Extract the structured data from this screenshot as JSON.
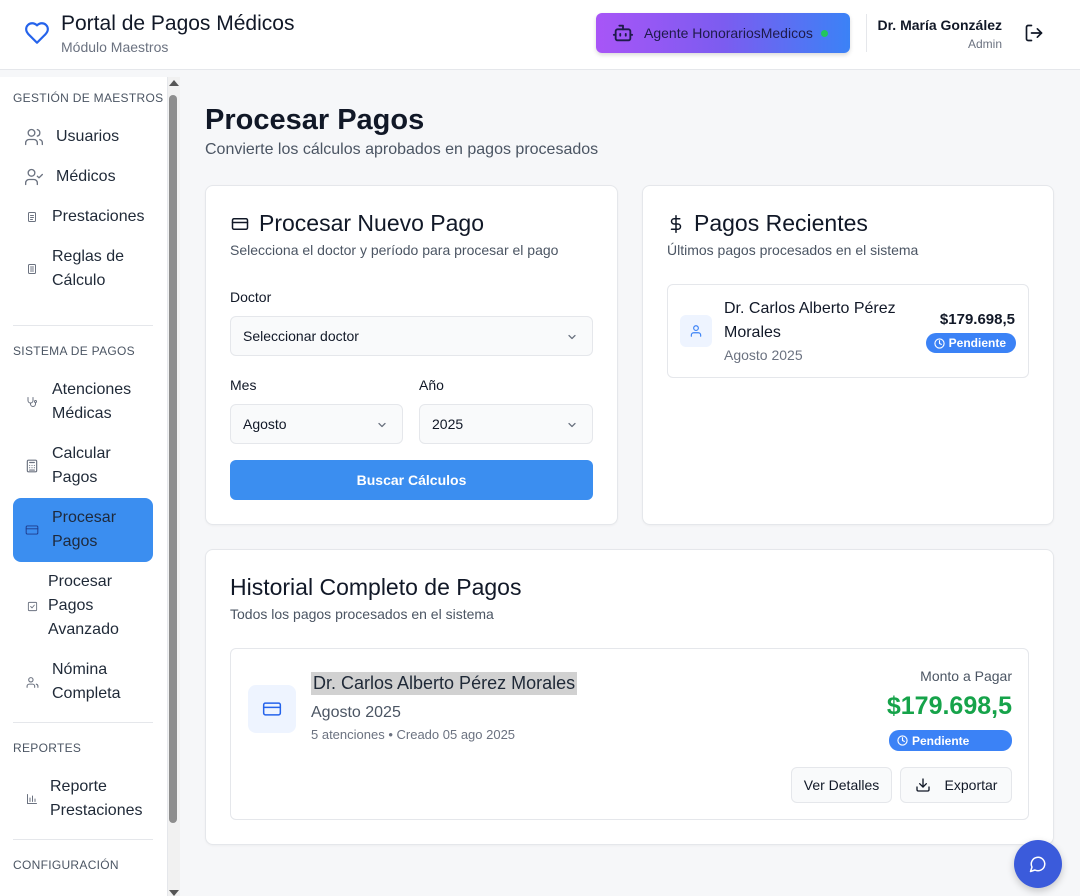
{
  "header": {
    "app_title": "Portal de Pagos Médicos",
    "app_subtitle": "Módulo Maestros",
    "agent_label": "Agente HonorariosMedicos",
    "user_name": "Dr. María González",
    "user_role": "Admin"
  },
  "sidebar": {
    "sections": [
      {
        "title": "GESTIÓN DE MAESTROS"
      },
      {
        "title": "SISTEMA DE PAGOS"
      },
      {
        "title": "REPORTES"
      },
      {
        "title": "CONFIGURACIÓN"
      }
    ],
    "items": [
      {
        "label": "Usuarios",
        "icon": "users-icon"
      },
      {
        "label": "Médicos",
        "icon": "user-check-icon"
      },
      {
        "label": "Prestaciones",
        "icon": "clipboard-icon"
      },
      {
        "label": "Reglas de Cálculo",
        "icon": "file-text-icon"
      },
      {
        "label": "Atenciones Médicas",
        "icon": "stethoscope-icon"
      },
      {
        "label": "Calcular Pagos",
        "icon": "calculator-icon"
      },
      {
        "label": "Procesar Pagos",
        "icon": "credit-card-icon"
      },
      {
        "label": "Procesar Pagos Avanzado",
        "icon": "check-square-icon"
      },
      {
        "label": "Nómina Completa",
        "icon": "users-icon"
      },
      {
        "label": "Reporte Prestaciones",
        "icon": "bar-chart-icon"
      }
    ]
  },
  "main": {
    "title": "Procesar Pagos",
    "subtitle": "Convierte los cálculos aprobados en pagos procesados"
  },
  "new_payment": {
    "title": "Procesar Nuevo Pago",
    "description": "Selecciona el doctor y período para procesar el pago",
    "doctor_label": "Doctor",
    "doctor_value": "Seleccionar doctor",
    "month_label": "Mes",
    "month_value": "Agosto",
    "year_label": "Año",
    "year_value": "2025",
    "search_button": "Buscar Cálculos"
  },
  "recent_payments": {
    "title": "Pagos Recientes",
    "description": "Últimos pagos procesados en el sistema",
    "items": [
      {
        "doctor": "Dr. Carlos Alberto Pérez Morales",
        "period": "Agosto 2025",
        "amount": "$179.698,5",
        "status": "Pendiente"
      }
    ]
  },
  "history": {
    "title": "Historial Completo de Pagos",
    "description": "Todos los pagos procesados en el sistema",
    "items": [
      {
        "doctor": "Dr. Carlos Alberto Pérez Morales",
        "period": "Agosto 2025",
        "meta": "5 atenciones • Creado 05 ago 2025",
        "amount_label": "Monto a Pagar",
        "amount": "$179.698,5",
        "status": "Pendiente",
        "details_button": "Ver Detalles",
        "export_button": "Exportar"
      }
    ]
  },
  "colors": {
    "primary": "#3b8ef0",
    "success": "#16a34a",
    "badge": "#3b82f6",
    "agent_gradient_start": "#a855f7",
    "agent_gradient_end": "#3b82f6"
  }
}
